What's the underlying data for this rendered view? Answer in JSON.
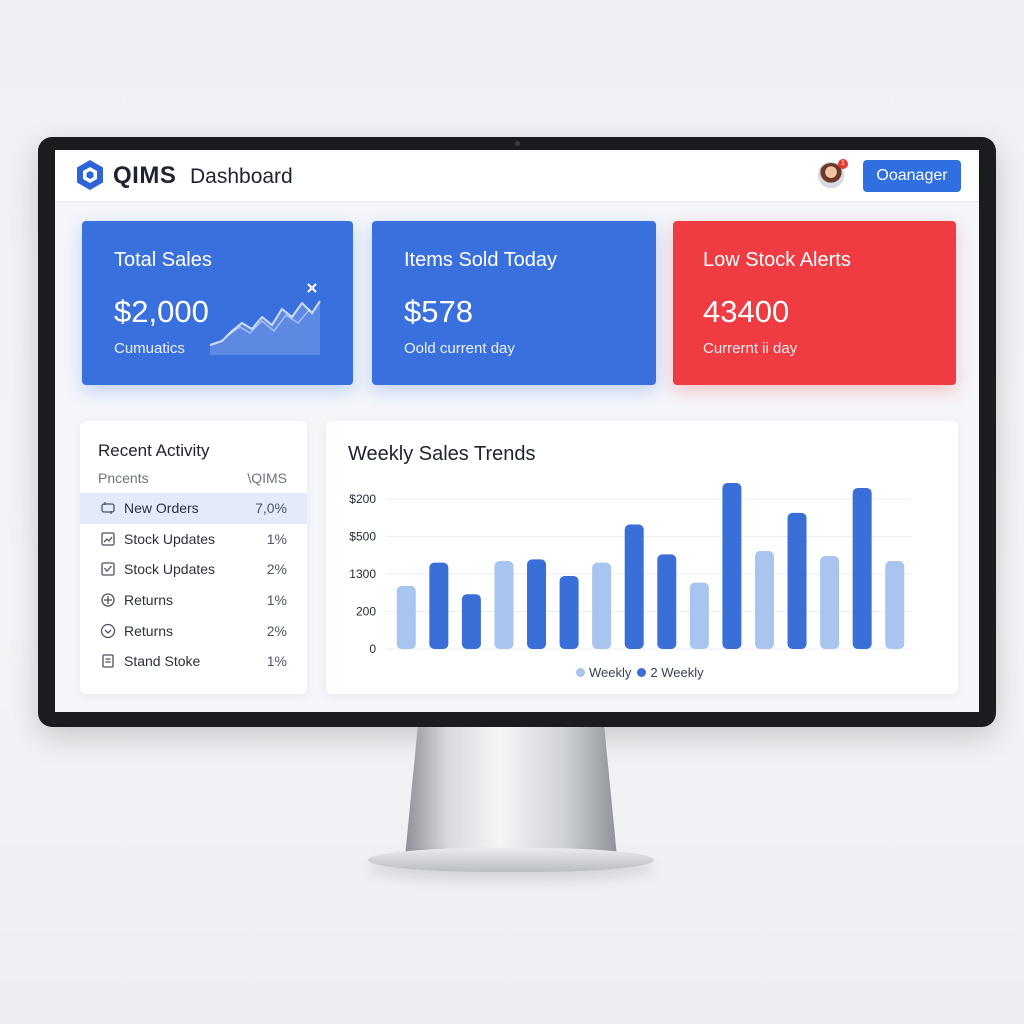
{
  "header": {
    "app_name": "QIMS",
    "app_subtitle": "Dashboard",
    "role_button": "Ooanager",
    "avatar_badge": "1"
  },
  "cards": [
    {
      "title": "Total Sales",
      "value": "$2,000",
      "sub": "Cumuatics",
      "color": "#3a70dd"
    },
    {
      "title": "Items Sold Today",
      "value": "$578",
      "sub": "Oold current day",
      "color": "#3a70dd"
    },
    {
      "title": "Low Stock Alerts",
      "value": "43400",
      "sub": "Currernt ii day",
      "color": "#ee3c42"
    }
  ],
  "activity": {
    "title": "Recent Activity",
    "col_left": "Pncents",
    "col_right": "\\QIMS",
    "rows": [
      {
        "label": "New Orders",
        "value": "7,0%",
        "icon": "orders-icon"
      },
      {
        "label": "Stock Updates",
        "value": "1%",
        "icon": "trend-icon"
      },
      {
        "label": "Stock Updates",
        "value": "2%",
        "icon": "check-box-icon"
      },
      {
        "label": "Returns",
        "value": "1%",
        "icon": "return-icon"
      },
      {
        "label": "Returns",
        "value": "2%",
        "icon": "chevron-circle-icon"
      },
      {
        "label": "Stand Stoke",
        "value": "1%",
        "icon": "document-icon"
      }
    ]
  },
  "chart_data": {
    "type": "bar",
    "title": "Weekly Sales Trends",
    "y_ticks": [
      "$200",
      "$500",
      "1300",
      "200",
      "0"
    ],
    "series": [
      {
        "name": "Weekly",
        "color": "#a9c4ee"
      },
      {
        "name": "2 Weekly",
        "color": "#3a6fd8"
      }
    ],
    "bars": [
      {
        "series": 0,
        "value": 0.38
      },
      {
        "series": 1,
        "value": 0.52
      },
      {
        "series": 1,
        "value": 0.33
      },
      {
        "series": 0,
        "value": 0.53
      },
      {
        "series": 1,
        "value": 0.54
      },
      {
        "series": 1,
        "value": 0.44
      },
      {
        "series": 0,
        "value": 0.52
      },
      {
        "series": 1,
        "value": 0.75
      },
      {
        "series": 1,
        "value": 0.57
      },
      {
        "series": 0,
        "value": 0.4
      },
      {
        "series": 1,
        "value": 1.0
      },
      {
        "series": 0,
        "value": 0.59
      },
      {
        "series": 1,
        "value": 0.82
      },
      {
        "series": 0,
        "value": 0.56
      },
      {
        "series": 1,
        "value": 0.97
      },
      {
        "series": 0,
        "value": 0.53
      }
    ],
    "grid": true,
    "legend_position": "bottom-center"
  }
}
